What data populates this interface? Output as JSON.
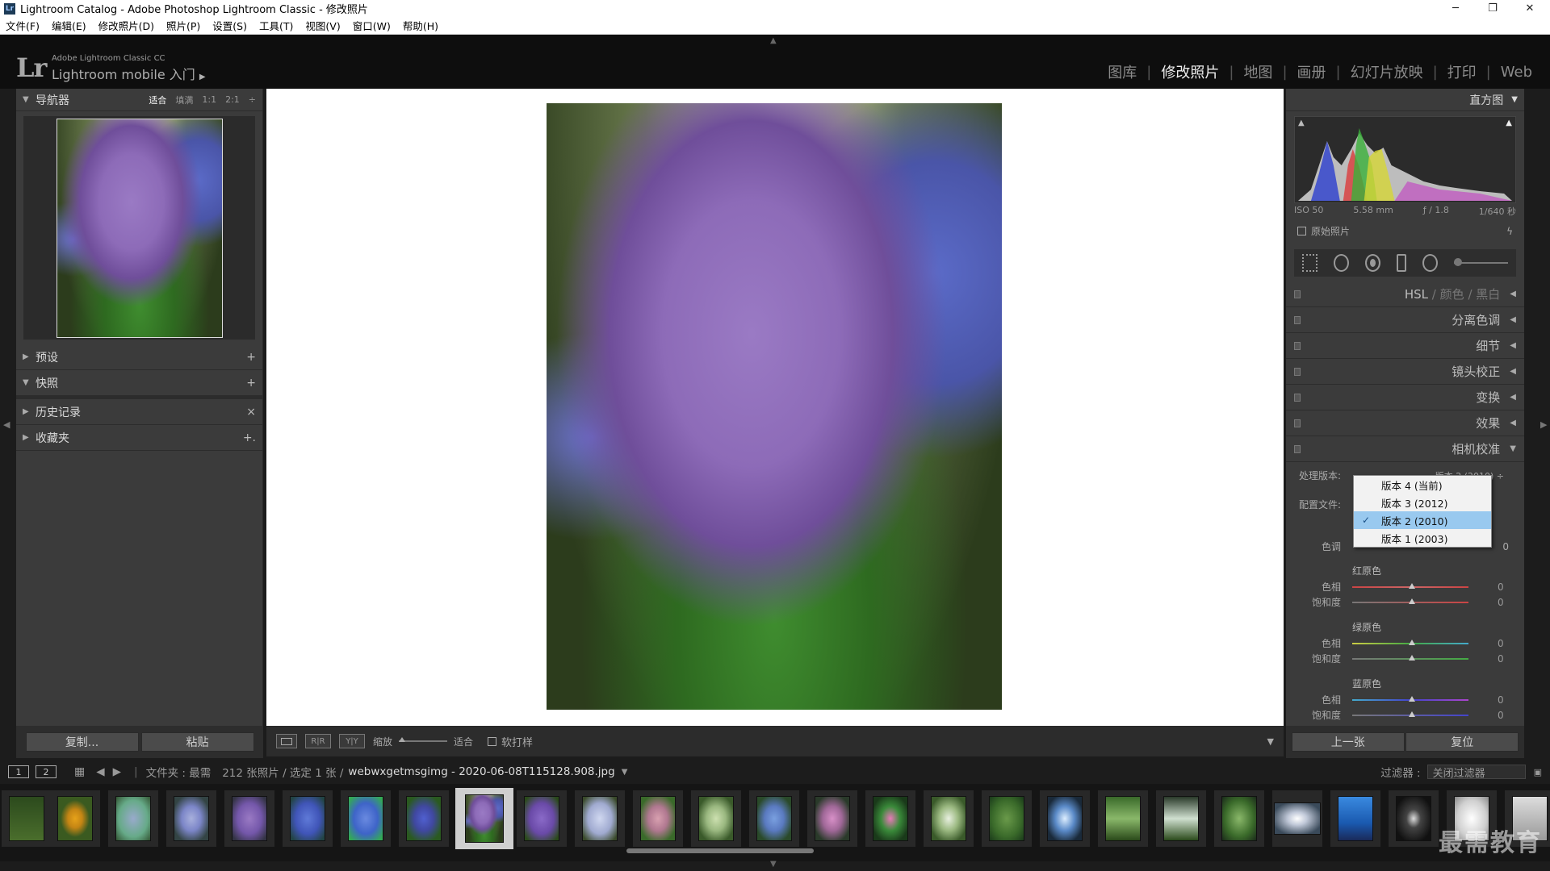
{
  "window": {
    "title": "Lightroom Catalog - Adobe Photoshop Lightroom Classic - 修改照片",
    "app_icon": "Lr",
    "controls": [
      "─",
      "❐",
      "✕"
    ]
  },
  "menu": [
    "文件(F)",
    "编辑(E)",
    "修改照片(D)",
    "照片(P)",
    "设置(S)",
    "工具(T)",
    "视图(V)",
    "窗口(W)",
    "帮助(H)"
  ],
  "identity": {
    "logo": "Lr",
    "small": "Adobe Lightroom Classic CC",
    "main": "Lightroom mobile 入门",
    "arrow": "▶"
  },
  "modules": [
    {
      "label": "图库",
      "active": false
    },
    {
      "label": "修改照片",
      "active": true
    },
    {
      "label": "地图",
      "active": false
    },
    {
      "label": "画册",
      "active": false
    },
    {
      "label": "幻灯片放映",
      "active": false
    },
    {
      "label": "打印",
      "active": false
    },
    {
      "label": "Web",
      "active": false
    }
  ],
  "navigator": {
    "title": "导航器",
    "zoom_options": [
      "适合",
      "填满",
      "1:1",
      "2:1"
    ],
    "zoom_more": "÷"
  },
  "left_sections": [
    {
      "label": "预设",
      "icon": "+",
      "collapsed": true
    },
    {
      "label": "快照",
      "icon": "+",
      "collapsed": false
    },
    {
      "label": "历史记录",
      "icon": "×",
      "collapsed": true
    },
    {
      "label": "收藏夹",
      "icon": "+.",
      "collapsed": true
    }
  ],
  "left_buttons": {
    "copy": "复制...",
    "paste": "粘贴"
  },
  "toolbar": {
    "view_a": "",
    "view_b": "R|R",
    "view_c": "Y|Y",
    "zoom_label": "缩放",
    "zoom_value": "适合",
    "softproof": "软打样"
  },
  "histogram": {
    "title": "直方图",
    "iso": "ISO 50",
    "focal": "5.58 mm",
    "aperture": "ƒ / 1.8",
    "shutter": "1/640 秒",
    "original": "原始照片"
  },
  "right_sections": [
    {
      "label_parts": [
        "HSL",
        "/",
        "颜色",
        "/",
        "黑白"
      ],
      "arrow": "◀"
    },
    {
      "label": "分离色调",
      "arrow": "◀"
    },
    {
      "label": "细节",
      "arrow": "◀"
    },
    {
      "label": "镜头校正",
      "arrow": "◀"
    },
    {
      "label": "变换",
      "arrow": "◀"
    },
    {
      "label": "效果",
      "arrow": "◀"
    },
    {
      "label": "相机校准",
      "arrow": "▼"
    }
  ],
  "calibration": {
    "process_label": "处理版本:",
    "process_value": "版本 2 (2010) ÷",
    "profile_label": "配置文件:",
    "tint_label": "色调",
    "tint_value": "0",
    "red_title": "红原色",
    "green_title": "绿原色",
    "blue_title": "蓝原色",
    "hue_label": "色相",
    "sat_label": "饱和度",
    "zero": "0",
    "colors": {
      "red": "#c24a4a",
      "green": "#4aa84a",
      "blue": "#4a55c8"
    }
  },
  "dropdown": {
    "options": [
      {
        "label": "版本 4 (当前)",
        "selected": false
      },
      {
        "label": "版本 3 (2012)",
        "selected": false
      },
      {
        "label": "版本 2 (2010)",
        "selected": true
      },
      {
        "label": "版本 1 (2003)",
        "selected": false
      }
    ],
    "checkmark": "✓"
  },
  "right_buttons": {
    "prev": "上一张",
    "reset": "复位"
  },
  "filmbar": {
    "screen1": "1",
    "screen2": "2",
    "folder": "文件夹 : 最需",
    "count": "212 张照片 / 选定 1 张 /",
    "filename": "webwxgetmsgimg - 2020-06-08T115128.908.jpg",
    "filter_label": "过滤器 :",
    "filter_value": "关闭过滤器"
  },
  "watermark": "最需教育"
}
